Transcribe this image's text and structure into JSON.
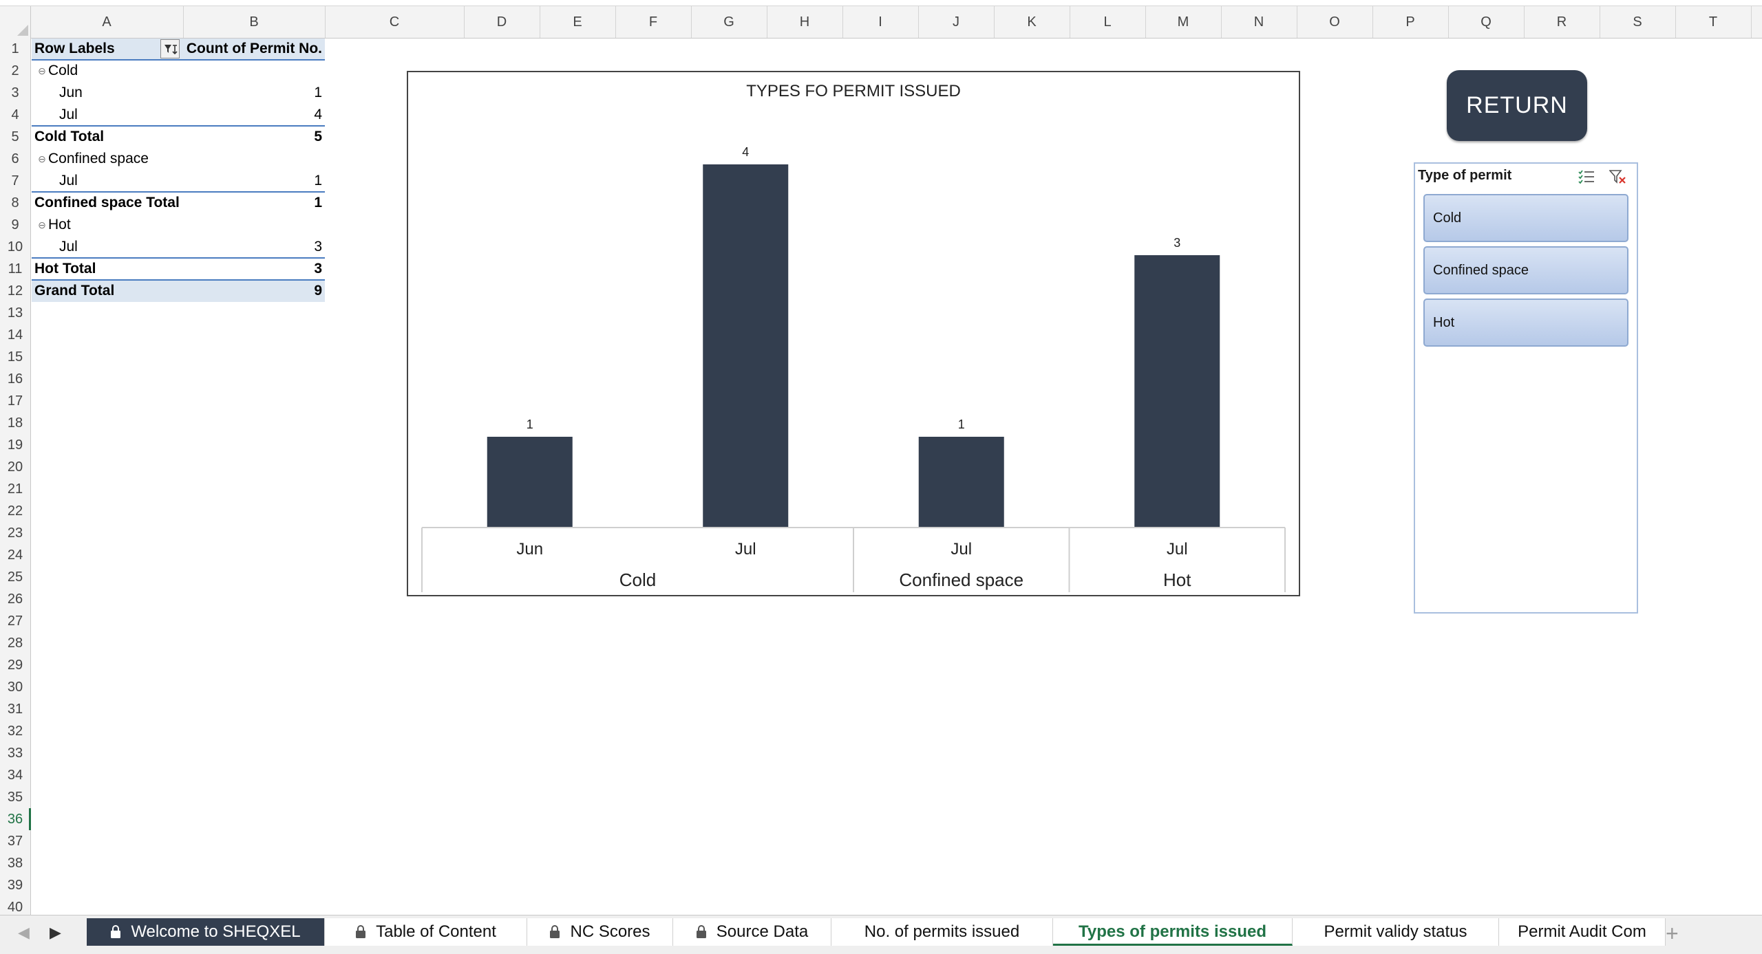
{
  "columns": [
    "A",
    "B",
    "C",
    "D",
    "E",
    "F",
    "G",
    "H",
    "I",
    "J",
    "K",
    "L",
    "M",
    "N",
    "O",
    "P",
    "Q",
    "R",
    "S",
    "T"
  ],
  "rows": [
    "1",
    "2",
    "3",
    "4",
    "5",
    "6",
    "7",
    "8",
    "9",
    "10",
    "11",
    "12",
    "13",
    "14",
    "15",
    "16",
    "17",
    "18",
    "19",
    "20",
    "21",
    "22",
    "23",
    "24",
    "25",
    "26",
    "27",
    "28",
    "29",
    "30",
    "31",
    "32",
    "33",
    "34",
    "35",
    "36",
    "37",
    "38",
    "39",
    "40"
  ],
  "active_row": "36",
  "pivot": {
    "header_row_labels": "Row Labels",
    "header_count": "Count of Permit No.",
    "rows": [
      {
        "label": "Cold",
        "value": "",
        "kind": "group"
      },
      {
        "label": "Jun",
        "value": "1",
        "kind": "item"
      },
      {
        "label": "Jul",
        "value": "4",
        "kind": "item"
      },
      {
        "label": "Cold Total",
        "value": "5",
        "kind": "total"
      },
      {
        "label": "Confined space",
        "value": "",
        "kind": "group"
      },
      {
        "label": "Jul",
        "value": "1",
        "kind": "item"
      },
      {
        "label": "Confined space Total",
        "value": "1",
        "kind": "total"
      },
      {
        "label": "Hot",
        "value": "",
        "kind": "group"
      },
      {
        "label": "Jul",
        "value": "3",
        "kind": "item"
      },
      {
        "label": "Hot Total",
        "value": "3",
        "kind": "total"
      },
      {
        "label": "Grand Total",
        "value": "9",
        "kind": "grand"
      }
    ]
  },
  "chart_data": {
    "type": "bar",
    "title": "TYPES FO PERMIT ISSUED",
    "categories": [
      "Jun",
      "Jul",
      "Jul",
      "Jul"
    ],
    "groups": [
      {
        "name": "Cold",
        "span": 2
      },
      {
        "name": "Confined space",
        "span": 1
      },
      {
        "name": "Hot",
        "span": 1
      }
    ],
    "values": [
      1,
      4,
      1,
      3
    ],
    "data_labels": [
      "1",
      "4",
      "1",
      "3"
    ],
    "ylim": [
      0,
      4
    ],
    "grid": false,
    "legend": "none",
    "bar_color": "#333e4f"
  },
  "return_button": {
    "label": "RETURN"
  },
  "slicer": {
    "title": "Type of permit",
    "items": [
      "Cold",
      "Confined space",
      "Hot"
    ],
    "icons": [
      "multi-select-icon",
      "clear-filter-icon"
    ]
  },
  "tabs": [
    {
      "label": "Welcome to SHEQXEL",
      "locked": true,
      "style": "dark"
    },
    {
      "label": "Table of Content",
      "locked": true,
      "style": "normal"
    },
    {
      "label": "NC Scores",
      "locked": true,
      "style": "normal"
    },
    {
      "label": "Source Data",
      "locked": true,
      "style": "normal"
    },
    {
      "label": "No. of permits issued",
      "locked": false,
      "style": "normal"
    },
    {
      "label": "Types of permits issued",
      "locked": false,
      "style": "active"
    },
    {
      "label": "Permit validy status",
      "locked": false,
      "style": "normal"
    },
    {
      "label": "Permit Audit Com",
      "locked": false,
      "style": "normal"
    }
  ],
  "colors": {
    "accent": "#217346",
    "table_line": "#4a7cc0",
    "header_fill": "#dce6f1",
    "button": "#333e4f"
  }
}
